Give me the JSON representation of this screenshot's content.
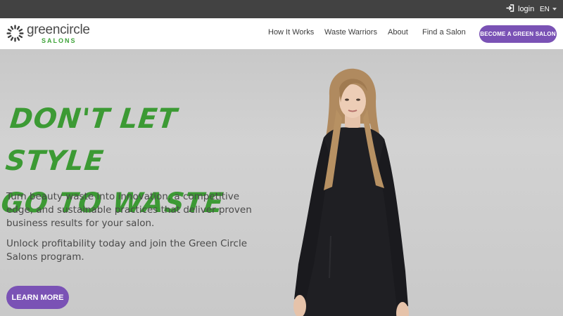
{
  "topbar": {
    "login_label": "login",
    "language": "EN"
  },
  "nav": {
    "logo_main": "greencircle",
    "logo_sub": "SALONS",
    "links": [
      "How It Works",
      "Waste Warriors",
      "About",
      "Find a Salon"
    ],
    "cta": "BECOME A GREEN SALON"
  },
  "hero": {
    "headline_line1": "DON'T LET STYLE",
    "headline_line2": "GO TO WASTE",
    "paragraph1": "Turn beauty waste into innovation, a competitive edge, and sustainable practices that deliver proven business results for your salon.",
    "paragraph2": "Unlock profitability today and join the Green Circle Salons program.",
    "button": "LEARN MORE"
  },
  "colors": {
    "brand_green": "#3c9a34",
    "brand_purple": "#7a52b5",
    "topbar": "#424242"
  },
  "icons": [
    "login-icon",
    "caret-down-icon",
    "logo-mark-icon"
  ]
}
